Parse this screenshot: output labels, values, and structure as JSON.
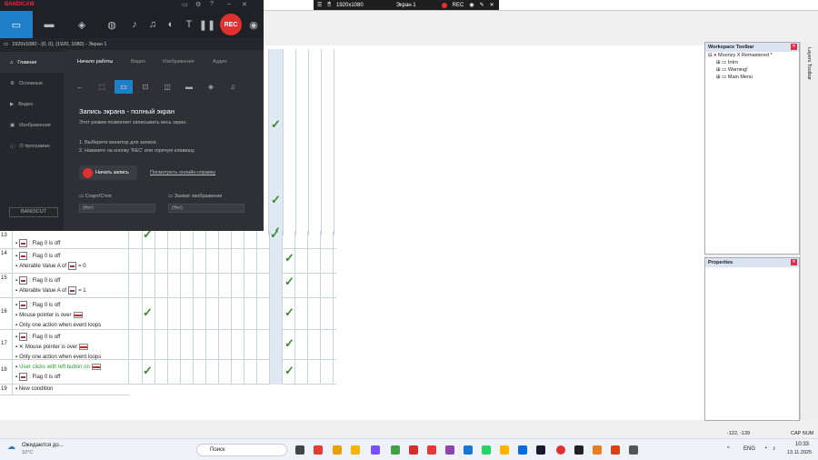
{
  "topbar": {
    "resolution": "1920x1080",
    "screen": "Экран 1",
    "rec": "REC"
  },
  "bandicam": {
    "brand": "BANDICAM",
    "brand2": "BANDICUT",
    "rec_button": "REC",
    "subbar": "1920x1080 - (0, 0), (1920, 1080) - Экран 1",
    "sidebar": [
      "Главная",
      "Основные",
      "Видео",
      "Изображения",
      "О программе"
    ],
    "tabs": [
      "Начало работы",
      "Видео",
      "Изображения",
      "Аудио"
    ],
    "title": "Запись экрана - полный экран",
    "desc": "Этот режим позволяет записывать весь экран.",
    "step1": "1. Выберите монитор для записи.",
    "step2": "2. Нажмите на кнопку 'REC' или горячую клавишу.",
    "start_label": "Начать запись",
    "help_link": "Посмотреть онлайн-справку",
    "hotkey_record_label": "Старт/Стоп",
    "hotkey_record_value": "(Нет)",
    "hotkey_capture_label": "Захват изображения",
    "hotkey_capture_value": "(Нет)"
  },
  "events": {
    "rows": [
      {
        "num": "13",
        "lines": [
          "",
          ": Flag 0 is off"
        ]
      },
      {
        "num": "14",
        "lines": [
          ": Flag 0 is off",
          "Alterable Value A of",
          "= 0"
        ]
      },
      {
        "num": "15",
        "lines": [
          ": Flag 0 is off",
          "Alterable Value A of",
          "= 1"
        ]
      },
      {
        "num": "16",
        "lines": [
          ": Flag 0 is off",
          "Mouse pointer is over",
          "Only one action when event loops"
        ]
      },
      {
        "num": "17",
        "lines": [
          ": Flag 0 is off",
          "Mouse pointer is over",
          "Only one action when event loops"
        ]
      },
      {
        "num": "18",
        "lines": [
          "User clicks with left button on",
          ": Flag 0 is off"
        ]
      },
      {
        "num": "19",
        "lines": [
          "New condition"
        ]
      }
    ]
  },
  "workspace": {
    "title": "Workspace Toolbar",
    "root": "Moonzy X Remastered *",
    "nodes": [
      "Intro",
      "Warning!",
      "Main Menu"
    ],
    "side_tabs": "Layers Toolbar"
  },
  "properties": {
    "title": "Properties"
  },
  "status": {
    "coords": "-122, -139",
    "caps": "CAP NUM"
  },
  "taskbar": {
    "weather": "Ожидаются до...",
    "temp": "10°C",
    "search": "Поиск",
    "lang": "ENG",
    "time": "10:33",
    "date": "13.11.2025"
  }
}
